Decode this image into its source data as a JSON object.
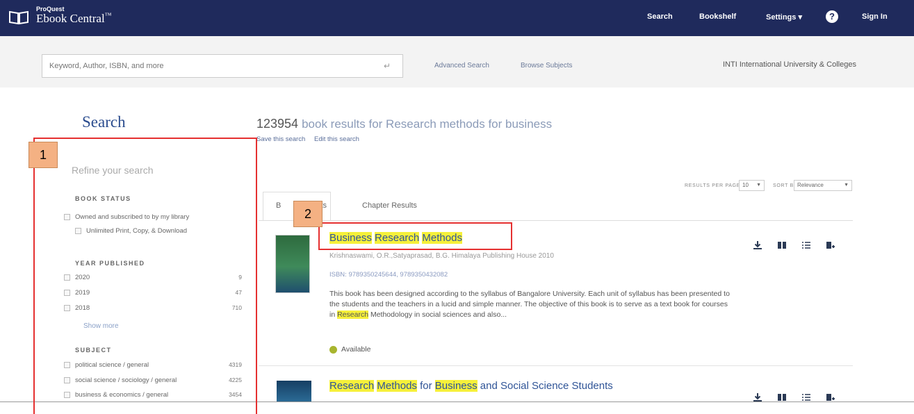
{
  "app": {
    "brand_small": "ProQuest",
    "brand_name": "Ebook Central",
    "brand_tm": "™"
  },
  "nav": {
    "search": "Search",
    "bookshelf": "Bookshelf",
    "settings": "Settings ▾",
    "sign_in": "Sign In"
  },
  "searchbar": {
    "placeholder": "Keyword, Author, ISBN, and more",
    "advanced": "Advanced Search",
    "browse": "Browse Subjects",
    "institution": "INTI International University & Colleges"
  },
  "sidebar": {
    "title": "Search",
    "refine": "Refine your search",
    "book_status": {
      "heading": "BOOK STATUS",
      "items": [
        {
          "label": "Owned and subscribed to by my library"
        },
        {
          "label": "Unlimited Print, Copy, & Download"
        }
      ]
    },
    "year_published": {
      "heading": "YEAR PUBLISHED",
      "items": [
        {
          "label": "2020",
          "count": "9"
        },
        {
          "label": "2019",
          "count": "47"
        },
        {
          "label": "2018",
          "count": "710"
        }
      ],
      "show_more": "Show more"
    },
    "subject": {
      "heading": "SUBJECT",
      "items": [
        {
          "label": "political science / general",
          "count": "4319"
        },
        {
          "label": "social science / sociology / general",
          "count": "4225"
        },
        {
          "label": "business & economics / general",
          "count": "3454"
        }
      ]
    }
  },
  "results": {
    "count": "123954",
    "summary": "book results for Research methods for business",
    "save": "Save this search",
    "edit": "Edit this search",
    "per_page_label": "RESULTS PER PAGE",
    "per_page_value": "10",
    "sort_label": "SORT BY",
    "sort_value": "Relevance",
    "tab_books_start": "B",
    "tab_books_end": "lts",
    "tab_chapters": "Chapter Results",
    "items": [
      {
        "title_parts": [
          "Business",
          " ",
          "Research",
          " ",
          "Methods"
        ],
        "authors": "Krishnaswami, O.R.,Satyaprasad, B.G.  Himalaya Publishing House  2010",
        "isbn": "ISBN: 9789350245644, 9789350432082",
        "desc_a": "This book has been designed according to the syllabus of Bangalore University. Each unit of syllabus has been presented to the students and the teachers in a lucid and simple manner. The objective of this book is to serve as a text book for courses in ",
        "desc_hl": "Research",
        "desc_b": " Methodology in social sciences and also...",
        "status": "Available"
      },
      {
        "title_parts": [
          "Research",
          " ",
          "Methods",
          " for ",
          "Business",
          " and Social Science Students"
        ]
      }
    ]
  },
  "annotations": {
    "badge1": "1",
    "badge2": "2",
    "color": "#e53030",
    "badge_color": "#f4b183"
  },
  "icons": [
    "book-logo-icon",
    "help-icon",
    "enter-icon",
    "download-icon",
    "read-online-icon",
    "toc-icon",
    "add-to-bookshelf-icon",
    "checkbox-icon"
  ]
}
